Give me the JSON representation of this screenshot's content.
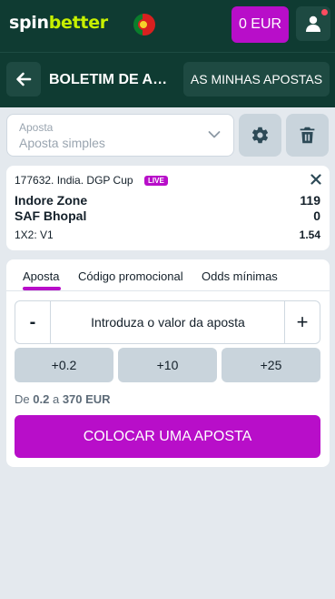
{
  "header": {
    "logo_part1": "spin",
    "logo_part2": "better",
    "balance_label": "0 EUR"
  },
  "subheader": {
    "title": "BOLETIM DE APOSTAS",
    "my_bets_label": "AS MINHAS APOSTAS"
  },
  "bet_type": {
    "label": "Aposta",
    "value": "Aposta simples"
  },
  "event": {
    "title": "177632. India. DGP Cup",
    "live_badge": "LIVE",
    "team1": "Indore Zone",
    "team1_score": "119",
    "team2": "SAF Bhopal",
    "team2_score": "0",
    "market": "1X2: V1",
    "odds": "1.54"
  },
  "stake": {
    "tabs": [
      {
        "label": "Aposta"
      },
      {
        "label": "Código promocional"
      },
      {
        "label": "Odds mínimas"
      }
    ],
    "active_tab": 0,
    "minus_label": "-",
    "plus_label": "+",
    "input_placeholder": "Introduza o valor da aposta",
    "quick_amounts": [
      {
        "label": "+0.2"
      },
      {
        "label": "+10"
      },
      {
        "label": "+25"
      }
    ],
    "range_prefix": "De",
    "range_min": "0.2",
    "range_mid": "a",
    "range_max": "370 EUR",
    "place_bet_label": "COLOCAR UMA APOSTA"
  },
  "colors": {
    "header_bg": "#0f3b32",
    "accent": "#b80ec9",
    "logo_accent": "#c7f000",
    "page_bg": "#e4e9ee"
  }
}
